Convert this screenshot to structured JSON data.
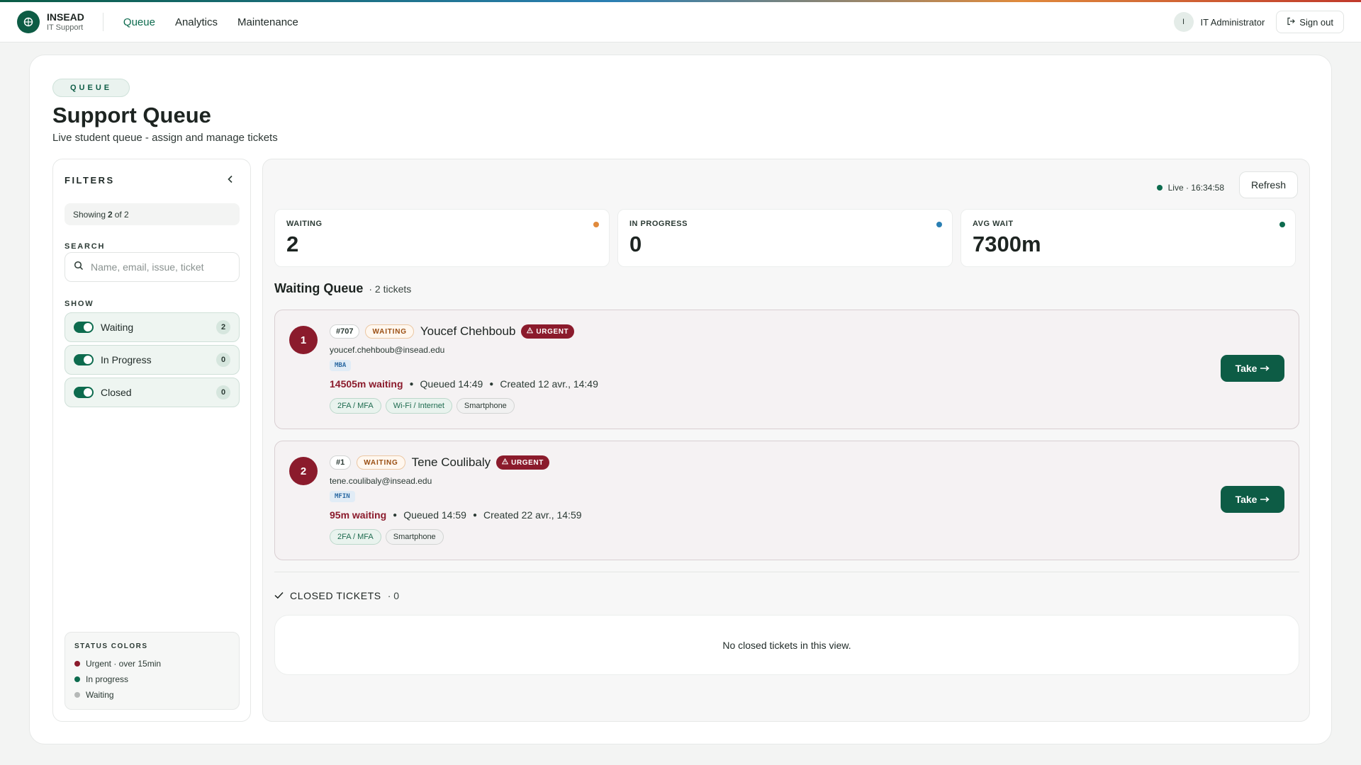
{
  "brand": {
    "name": "INSEAD",
    "sub": "IT Support"
  },
  "nav": [
    {
      "label": "Queue",
      "active": true
    },
    {
      "label": "Analytics",
      "active": false
    },
    {
      "label": "Maintenance",
      "active": false
    }
  ],
  "user": {
    "initial": "I",
    "name": "IT Administrator",
    "signout": "Sign out"
  },
  "page": {
    "eyebrow": "QUEUE",
    "title": "Support Queue",
    "subtitle": "Live student queue - assign and manage tickets"
  },
  "filters": {
    "title": "FILTERS",
    "showing_prefix": "Showing",
    "showing_count": "2",
    "showing_suffix": "of 2",
    "search_label": "SEARCH",
    "search_placeholder": "Name, email, issue, ticket",
    "show_label": "SHOW",
    "toggles": [
      {
        "label": "Waiting",
        "count": "2",
        "on": true
      },
      {
        "label": "In Progress",
        "count": "0",
        "on": true
      },
      {
        "label": "Closed",
        "count": "0",
        "on": true
      }
    ],
    "legend": {
      "title": "STATUS COLORS",
      "items": [
        {
          "label": "Urgent · over 15min",
          "color": "#8b1b2c"
        },
        {
          "label": "In progress",
          "color": "#0d6b4e"
        },
        {
          "label": "Waiting",
          "color": "#b5b8b7"
        }
      ]
    }
  },
  "live": {
    "text": "Live · 16:34:58",
    "refresh": "Refresh"
  },
  "stats": [
    {
      "label": "WAITING",
      "value": "2",
      "color": "#e08a3c"
    },
    {
      "label": "IN PROGRESS",
      "value": "0",
      "color": "#2a7fb3"
    },
    {
      "label": "AVG WAIT",
      "value": "7300m",
      "color": "#0d6b4e"
    }
  ],
  "queue": {
    "title": "Waiting Queue",
    "count": "· 2 tickets",
    "tickets": [
      {
        "rank": "1",
        "id": "#707",
        "status": "WAITING",
        "name": "Youcef Chehboub",
        "urgent": "URGENT",
        "email": "youcef.chehboub@insead.edu",
        "program": "MBA",
        "wait": "14505m waiting",
        "queued": "Queued 14:49",
        "created": "Created 12 avr., 14:49",
        "tags": [
          "2FA / MFA",
          "Wi-Fi / Internet",
          "Smartphone"
        ],
        "take": "Take"
      },
      {
        "rank": "2",
        "id": "#1",
        "status": "WAITING",
        "name": "Tene Coulibaly",
        "urgent": "URGENT",
        "email": "tene.coulibaly@insead.edu",
        "program": "MFIN",
        "wait": "95m waiting",
        "queued": "Queued 14:59",
        "created": "Created 22 avr., 14:59",
        "tags": [
          "2FA / MFA",
          "Smartphone"
        ],
        "take": "Take"
      }
    ]
  },
  "closed": {
    "title": "CLOSED TICKETS",
    "count": "· 0",
    "empty": "No closed tickets in this view."
  }
}
